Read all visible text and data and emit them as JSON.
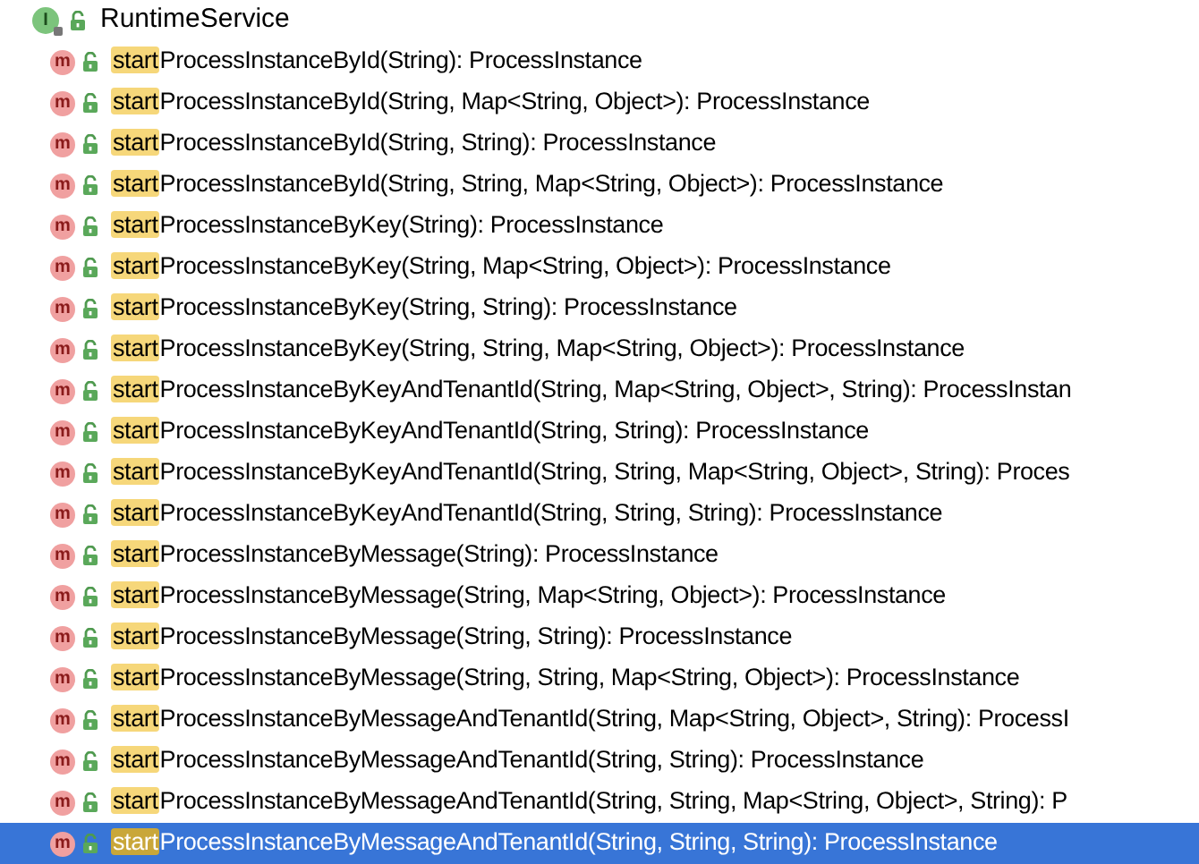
{
  "header": {
    "badge": "I",
    "title": "RuntimeService"
  },
  "methods": [
    {
      "badge": "m",
      "match": "start",
      "rest": "ProcessInstanceById(String): ProcessInstance",
      "selected": false
    },
    {
      "badge": "m",
      "match": "start",
      "rest": "ProcessInstanceById(String, Map<String, Object>): ProcessInstance",
      "selected": false
    },
    {
      "badge": "m",
      "match": "start",
      "rest": "ProcessInstanceById(String, String): ProcessInstance",
      "selected": false
    },
    {
      "badge": "m",
      "match": "start",
      "rest": "ProcessInstanceById(String, String, Map<String, Object>): ProcessInstance",
      "selected": false
    },
    {
      "badge": "m",
      "match": "start",
      "rest": "ProcessInstanceByKey(String): ProcessInstance",
      "selected": false
    },
    {
      "badge": "m",
      "match": "start",
      "rest": "ProcessInstanceByKey(String, Map<String, Object>): ProcessInstance",
      "selected": false
    },
    {
      "badge": "m",
      "match": "start",
      "rest": "ProcessInstanceByKey(String, String): ProcessInstance",
      "selected": false
    },
    {
      "badge": "m",
      "match": "start",
      "rest": "ProcessInstanceByKey(String, String, Map<String, Object>): ProcessInstance",
      "selected": false
    },
    {
      "badge": "m",
      "match": "start",
      "rest": "ProcessInstanceByKeyAndTenantId(String, Map<String, Object>, String): ProcessInstan",
      "selected": false
    },
    {
      "badge": "m",
      "match": "start",
      "rest": "ProcessInstanceByKeyAndTenantId(String, String): ProcessInstance",
      "selected": false
    },
    {
      "badge": "m",
      "match": "start",
      "rest": "ProcessInstanceByKeyAndTenantId(String, String, Map<String, Object>, String): Proces",
      "selected": false
    },
    {
      "badge": "m",
      "match": "start",
      "rest": "ProcessInstanceByKeyAndTenantId(String, String, String): ProcessInstance",
      "selected": false
    },
    {
      "badge": "m",
      "match": "start",
      "rest": "ProcessInstanceByMessage(String): ProcessInstance",
      "selected": false
    },
    {
      "badge": "m",
      "match": "start",
      "rest": "ProcessInstanceByMessage(String, Map<String, Object>): ProcessInstance",
      "selected": false
    },
    {
      "badge": "m",
      "match": "start",
      "rest": "ProcessInstanceByMessage(String, String): ProcessInstance",
      "selected": false
    },
    {
      "badge": "m",
      "match": "start",
      "rest": "ProcessInstanceByMessage(String, String, Map<String, Object>): ProcessInstance",
      "selected": false
    },
    {
      "badge": "m",
      "match": "start",
      "rest": "ProcessInstanceByMessageAndTenantId(String, Map<String, Object>, String): ProcessI",
      "selected": false
    },
    {
      "badge": "m",
      "match": "start",
      "rest": "ProcessInstanceByMessageAndTenantId(String, String): ProcessInstance",
      "selected": false
    },
    {
      "badge": "m",
      "match": "start",
      "rest": "ProcessInstanceByMessageAndTenantId(String, String, Map<String, Object>, String): P",
      "selected": false
    },
    {
      "badge": "m",
      "match": "start",
      "rest": "ProcessInstanceByMessageAndTenantId(String, String, String): ProcessInstance",
      "selected": true
    }
  ]
}
